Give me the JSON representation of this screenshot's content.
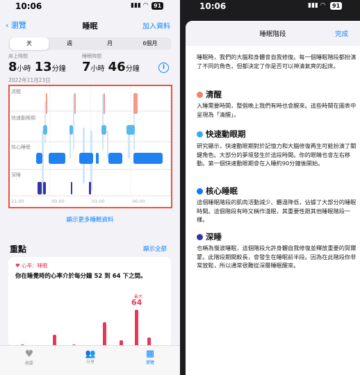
{
  "left": {
    "status": {
      "time": "10:06",
      "battery": "91"
    },
    "nav": {
      "back": "瀏覽",
      "title": "睡眠",
      "add": "加入資料"
    },
    "ranges": [
      "天",
      "週",
      "月",
      "6個月"
    ],
    "in_bed": {
      "label": "床上時間",
      "hours": "8",
      "hours_unit": "小時",
      "minutes": "13",
      "minutes_unit": "分鐘"
    },
    "asleep": {
      "label": "睡眠時間",
      "hours": "7",
      "hours_unit": "小時",
      "minutes": "46",
      "minutes_unit": "分鐘"
    },
    "date": "2022年11月23日",
    "chart_labels": {
      "awake": "清醒",
      "rem": "快速動眼期",
      "core": "核心睡眠",
      "deep": "深睡"
    },
    "time_ticks": [
      "21:00",
      "00:00",
      "03:00",
      "06:00"
    ],
    "more_link": "顯示更多睡眠資料",
    "highlights": {
      "title": "重點",
      "show_all": "顯示全部",
      "card_tag": "心率：睡眠",
      "card_text": "你在睡覺時的心率介於每分鐘 52 到 64 下之間。",
      "max_label": "最大",
      "max_value": "64"
    },
    "tabs": [
      "摘要",
      "分享",
      "瀏覽"
    ]
  },
  "right": {
    "status": {
      "time": "10:06",
      "battery": "91"
    },
    "title": "睡眠階段",
    "done": "完成",
    "intro": "睡眠時，我們的大腦和身體會自我修復。每一個睡眠階段都扮演了不同的角色，但都決定了你是否可以神清氣爽的起床。",
    "sections": [
      {
        "title": "清醒",
        "color": "#f4806a",
        "text": "入睡需要時間，整個晚上我們有時也會醒來。這些時間在圖表中呈現為「清醒」。"
      },
      {
        "title": "快速動眼期",
        "color": "#32ade6",
        "text": "研究顯示，快速動眼期對於記憶力和大腦修復再生可能扮演了關鍵角色。大部分的夢境發生於這段時間。你的眼睛也會左右移動。第一個快速動眼期會在入睡約90分鐘後開始。"
      },
      {
        "title": "核心睡眠",
        "color": "#0a7aff",
        "text": "這個睡眠階段的肌肉活動減少、體溫降低，佔據了大部分的睡眠時間。這個階段有時又稱作淺眠，其重要性跟其他睡眠階段一樣。"
      },
      {
        "title": "深睡",
        "color": "#3634a3",
        "text": "也稱為慢波睡眠，這個階段允許身體自我修復並釋放重要的賀爾蒙。此階段期間較長，會發生在睡眠前半段。因為在此階段你非常放鬆，所以通常很難從深層睡眠醒來。"
      }
    ]
  }
}
